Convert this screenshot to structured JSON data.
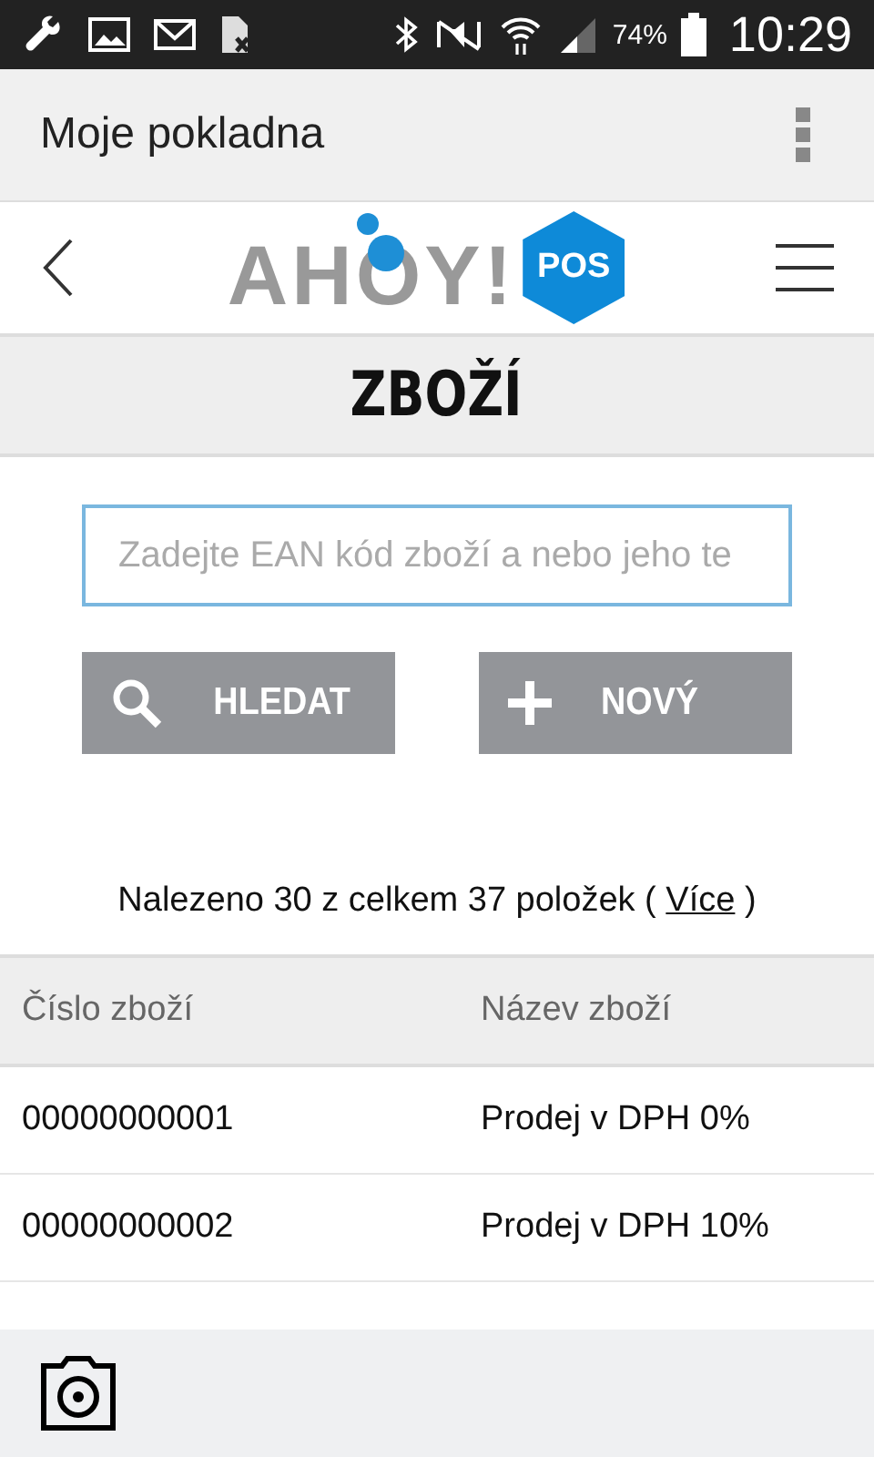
{
  "status_bar": {
    "battery": "74%",
    "time": "10:29"
  },
  "app_bar": {
    "title": "Moje pokladna"
  },
  "header": {
    "logo_text": "AHOY!",
    "logo_badge": "POS"
  },
  "page_title": "ZBOŽÍ",
  "search": {
    "placeholder": "Zadejte EAN kód zboží a nebo jeho te"
  },
  "buttons": [
    {
      "kind": "search",
      "label": "HLEDAT"
    },
    {
      "kind": "new",
      "label": "NOVÝ"
    }
  ],
  "result": {
    "text": "Nalezeno 30 z celkem 37 položek (",
    "link": "Více",
    "close": ")"
  },
  "table": {
    "columns": [
      "Číslo zboží",
      "Název zboží"
    ],
    "rows": [
      [
        "00000000001",
        "Prodej v DPH 0%"
      ],
      [
        "00000000002",
        "Prodej v DPH 10%"
      ]
    ]
  }
}
